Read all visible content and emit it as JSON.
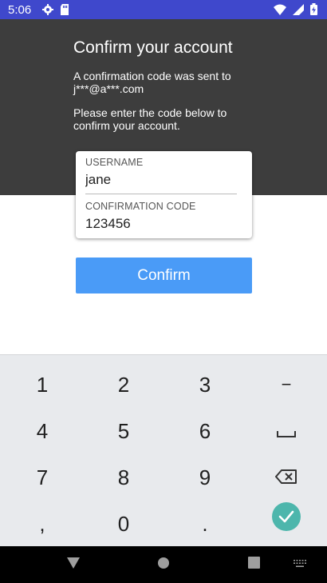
{
  "status_bar": {
    "time": "5:06",
    "icons": [
      "settings-icon",
      "sd-card-icon",
      "wifi-icon",
      "signal-icon",
      "battery-icon"
    ]
  },
  "screen": {
    "title": "Confirm your account",
    "subtitle": "A confirmation code was sent to j***@a***.com",
    "instructions": "Please enter the code below to confirm your account."
  },
  "form": {
    "username_label": "USERNAME",
    "username_value": "jane",
    "code_label": "CONFIRMATION CODE",
    "code_value": "123456",
    "confirm_label": "Confirm"
  },
  "keyboard": {
    "keys": [
      "1",
      "2",
      "3",
      "−",
      "4",
      "5",
      "6",
      "␣",
      "7",
      "8",
      "9",
      "backspace",
      ",",
      "0",
      ".",
      "done"
    ]
  },
  "nav_bar": {
    "buttons": [
      "back-icon",
      "home-icon",
      "recents-icon",
      "keyboard-switch-icon"
    ]
  },
  "colors": {
    "status_bar": "#3f48cc",
    "header": "#3d3d3d",
    "accent": "#4a9bf7",
    "done_key": "#4db6ac",
    "keyboard_bg": "#e8eaed"
  }
}
